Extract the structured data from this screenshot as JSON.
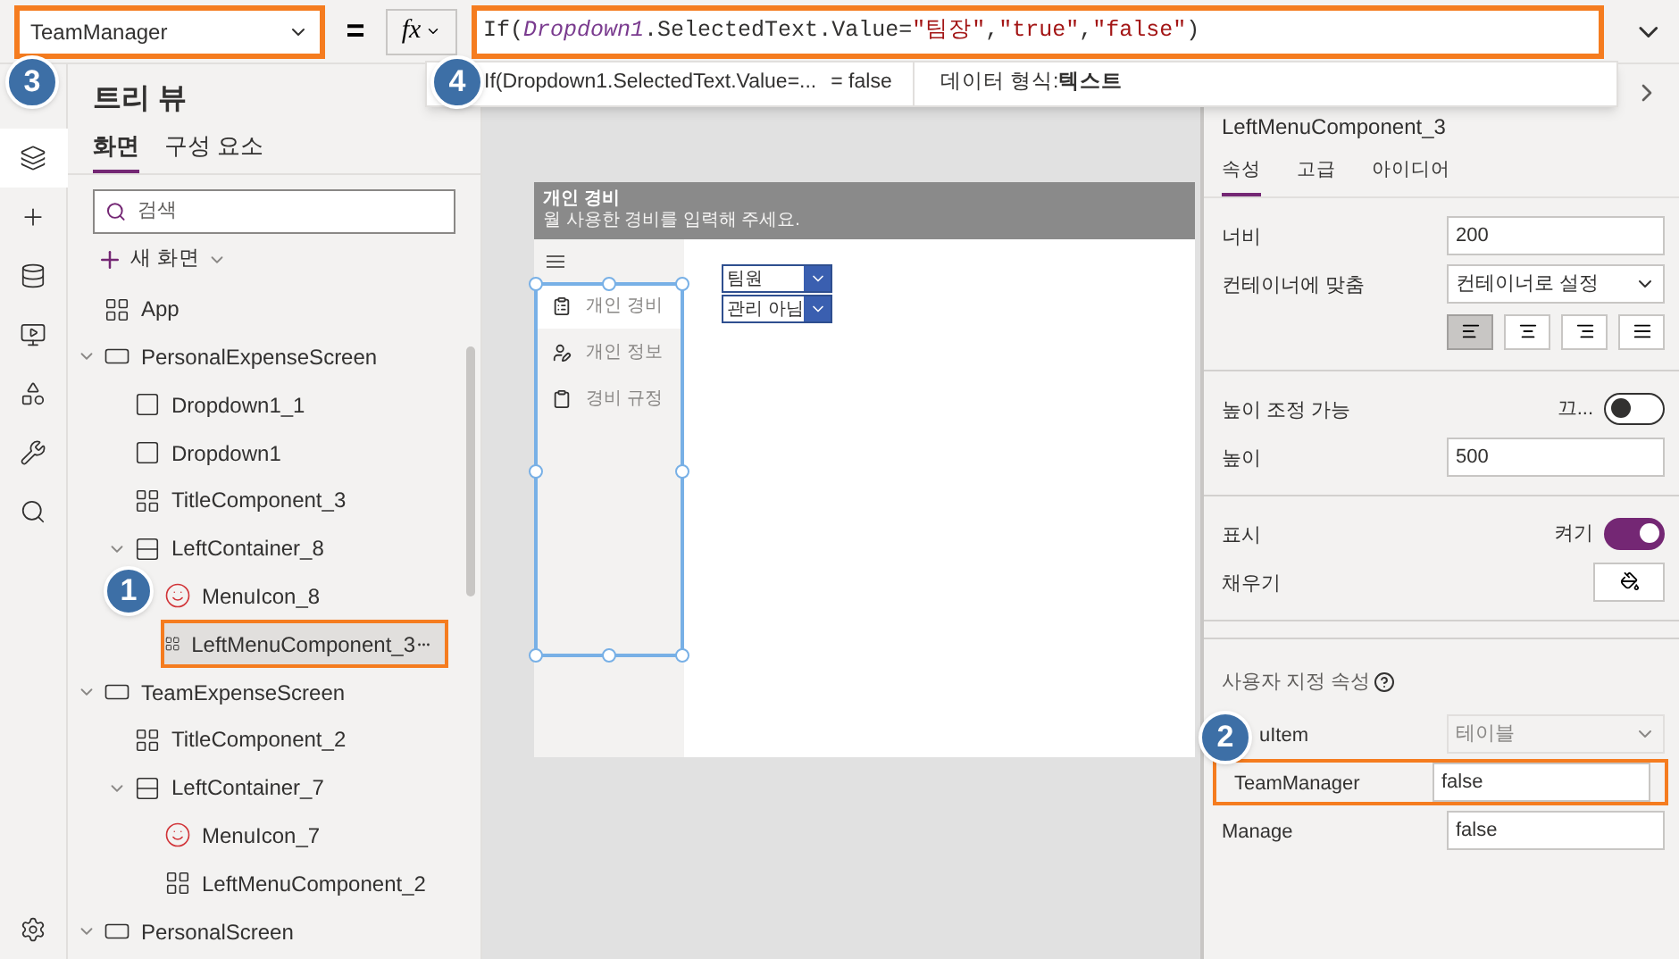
{
  "property_selector": {
    "value": "TeamManager",
    "highlighted": true
  },
  "equals": "=",
  "fx": "fx",
  "formula": {
    "highlighted": true,
    "parts": [
      {
        "kind": "plain",
        "text": "If("
      },
      {
        "kind": "ident",
        "text": "Dropdown1"
      },
      {
        "kind": "plain",
        "text": ".SelectedText.Value="
      },
      {
        "kind": "string",
        "text": "\"팀장\""
      },
      {
        "kind": "plain",
        "text": ","
      },
      {
        "kind": "string",
        "text": "\"true\""
      },
      {
        "kind": "plain",
        "text": ","
      },
      {
        "kind": "string",
        "text": "\"false\""
      },
      {
        "kind": "plain",
        "text": ")"
      }
    ]
  },
  "formula_preview": {
    "expression": "If(Dropdown1.SelectedText.Value=...",
    "result": "= false",
    "type_label": "데이터 형식:",
    "type_value": "텍스트"
  },
  "rail_items": [
    {
      "kind": "layers",
      "selected": true
    },
    {
      "kind": "insert",
      "selected": false
    },
    {
      "kind": "data",
      "selected": false
    },
    {
      "kind": "media",
      "selected": false
    },
    {
      "kind": "automate",
      "selected": false
    },
    {
      "kind": "tools",
      "selected": false
    },
    {
      "kind": "search",
      "selected": false
    },
    {
      "kind": "settings",
      "selected": false
    }
  ],
  "tree_panel": {
    "title": "트리 뷰",
    "tabs": [
      {
        "label": "화면",
        "selected": true
      },
      {
        "label": "구성 요소",
        "selected": false
      }
    ],
    "search": {
      "placeholder": "검색"
    },
    "new_screen": "새 화면",
    "items": [
      {
        "label": "App",
        "kind": "app",
        "selected": false,
        "highlighted": false
      },
      {
        "label": "PersonalExpenseScreen",
        "kind": "screen",
        "expanded": true,
        "selected": false,
        "highlighted": false,
        "children": [
          {
            "label": "Dropdown1_1",
            "kind": "dropdown",
            "selected": false,
            "highlighted": false
          },
          {
            "label": "Dropdown1",
            "kind": "dropdown",
            "selected": false,
            "highlighted": false
          },
          {
            "label": "TitleComponent_3",
            "kind": "component",
            "selected": false,
            "highlighted": false
          },
          {
            "label": "LeftContainer_8",
            "kind": "container",
            "expanded": true,
            "selected": false,
            "highlighted": false,
            "children": [
              {
                "label": "MenuIcon_8",
                "kind": "icon",
                "selected": false,
                "highlighted": false
              },
              {
                "label": "LeftMenuComponent_3",
                "kind": "component",
                "selected": true,
                "highlighted": true
              }
            ]
          }
        ]
      },
      {
        "label": "TeamExpenseScreen",
        "kind": "screen",
        "expanded": true,
        "selected": false,
        "highlighted": false,
        "children": [
          {
            "label": "TitleComponent_2",
            "kind": "component",
            "selected": false,
            "highlighted": false
          },
          {
            "label": "LeftContainer_7",
            "kind": "container",
            "expanded": true,
            "selected": false,
            "highlighted": false,
            "children": [
              {
                "label": "MenuIcon_7",
                "kind": "icon",
                "selected": false,
                "highlighted": false
              },
              {
                "label": "LeftMenuComponent_2",
                "kind": "component",
                "selected": false,
                "highlighted": false
              }
            ]
          }
        ]
      },
      {
        "label": "PersonalScreen",
        "kind": "screen",
        "expanded": true,
        "selected": false,
        "highlighted": false
      }
    ]
  },
  "canvas": {
    "header": {
      "title": "개인 경비",
      "subtitle": "월 사용한 경비를 입력해 주세요."
    },
    "menu": [
      {
        "label": "개인 경비",
        "kind": "expense",
        "selected": true
      },
      {
        "label": "개인 정보",
        "kind": "person",
        "selected": false
      },
      {
        "label": "경비 규정",
        "kind": "clipboard",
        "selected": false
      }
    ],
    "dropdowns": [
      {
        "value": "팀원"
      },
      {
        "value": "관리 아님"
      }
    ]
  },
  "properties": {
    "name": "LeftMenuComponent_3",
    "tabs": [
      {
        "label": "속성",
        "selected": true
      },
      {
        "label": "고급",
        "selected": false
      },
      {
        "label": "아이디어",
        "selected": false
      }
    ],
    "sections": [
      {
        "rows": [
          {
            "kind": "input",
            "label": "너비",
            "value": "200"
          },
          {
            "kind": "select",
            "label": "컨테이너에 맞춤",
            "value": "컨테이너로 설정"
          },
          {
            "kind": "align",
            "buttons": [
              {
                "kind": "left",
                "selected": true
              },
              {
                "kind": "center",
                "selected": false
              },
              {
                "kind": "right",
                "selected": false
              },
              {
                "kind": "stretch",
                "selected": false
              }
            ]
          }
        ]
      },
      {
        "rows": [
          {
            "kind": "toggle",
            "label": "높이 조정 가능",
            "state_text": "끄...",
            "on": false
          },
          {
            "kind": "input",
            "label": "높이",
            "value": "500"
          }
        ]
      },
      {
        "rows": [
          {
            "kind": "toggle",
            "label": "표시",
            "state_text": "켜기",
            "on": true
          },
          {
            "kind": "color",
            "label": "채우기"
          }
        ]
      }
    ],
    "custom": {
      "title": "사용자 지정 속성",
      "rows": [
        {
          "kind": "select",
          "label": "uItem",
          "value": "테이블",
          "disabled": true,
          "highlighted": false
        },
        {
          "kind": "input",
          "label": "TeamManager",
          "value": "false",
          "disabled": false,
          "highlighted": true
        },
        {
          "kind": "input",
          "label": "Manage",
          "value": "false",
          "disabled": false,
          "highlighted": false
        }
      ]
    }
  },
  "callouts": [
    {
      "label": "3"
    },
    {
      "label": "4"
    },
    {
      "label": "1"
    },
    {
      "label": "2"
    }
  ]
}
